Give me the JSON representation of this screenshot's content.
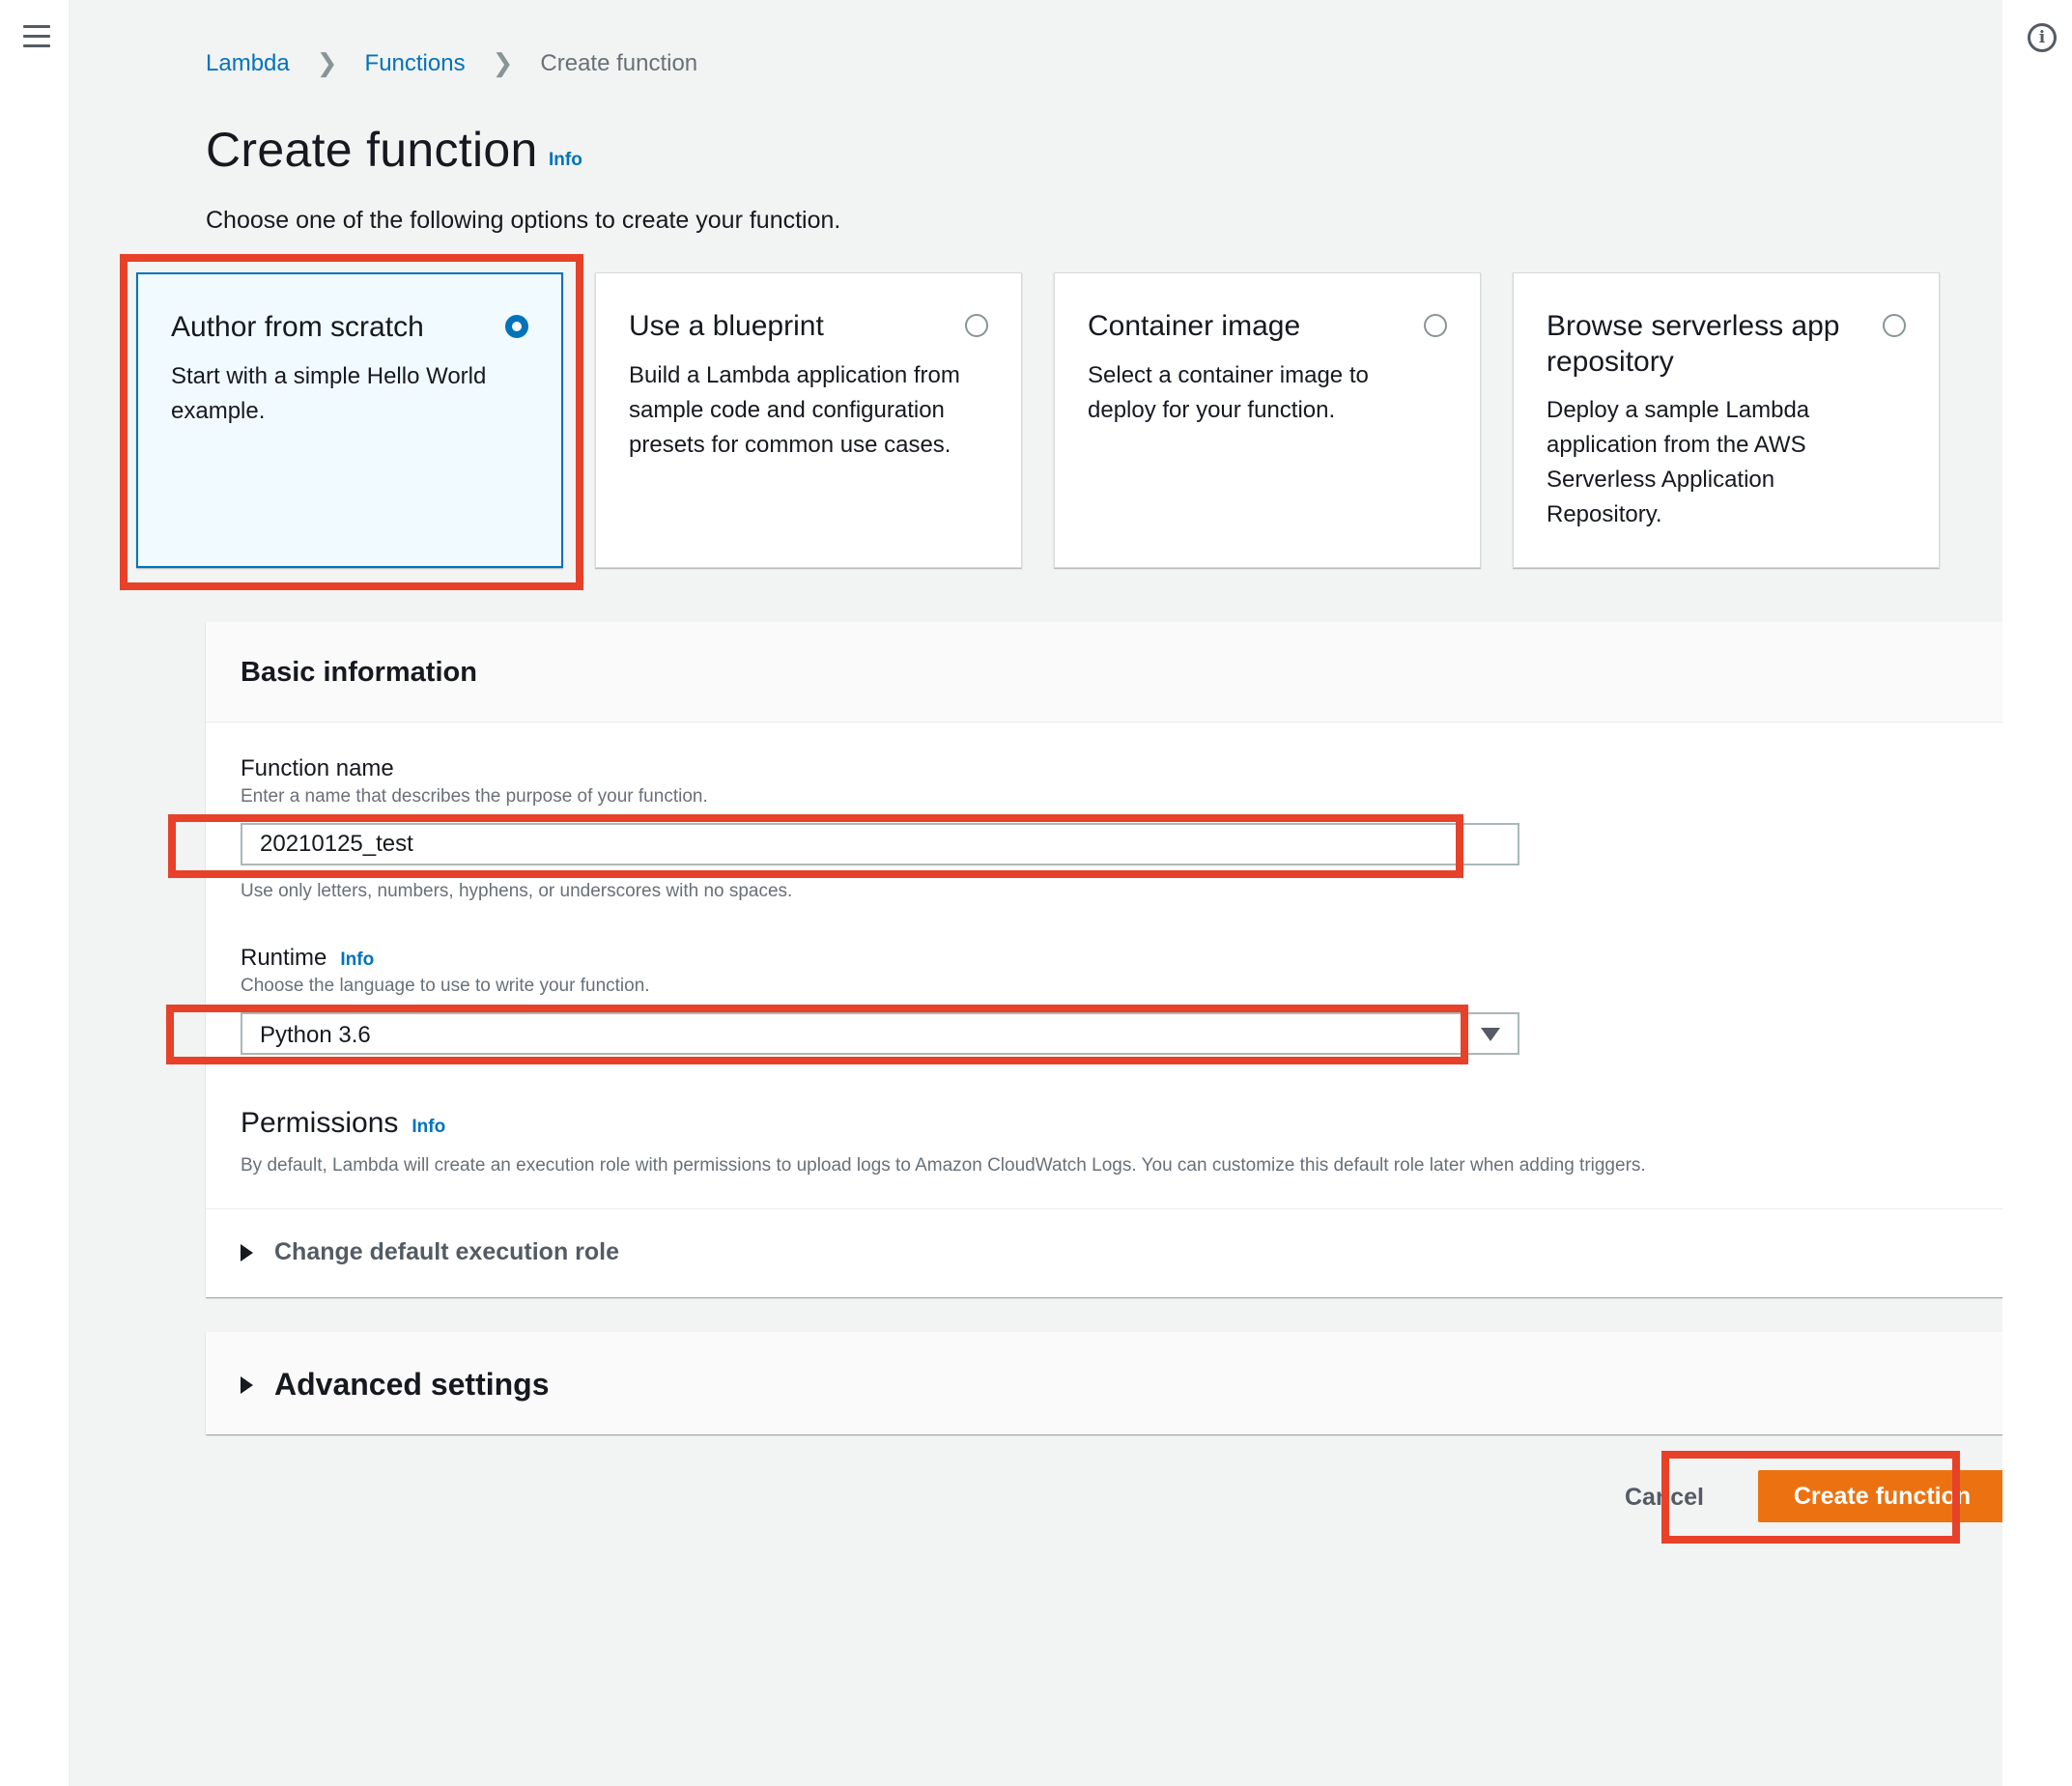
{
  "breadcrumb": {
    "item1": "Lambda",
    "item2": "Functions",
    "current": "Create function"
  },
  "page": {
    "title": "Create function",
    "title_info": "Info",
    "intro": "Choose one of the following options to create your function."
  },
  "options": [
    {
      "title": "Author from scratch",
      "description": "Start with a simple Hello World example.",
      "selected": true
    },
    {
      "title": "Use a blueprint",
      "description": "Build a Lambda application from sample code and configuration presets for common use cases.",
      "selected": false
    },
    {
      "title": "Container image",
      "description": "Select a container image to deploy for your function.",
      "selected": false
    },
    {
      "title": "Browse serverless app repository",
      "description": "Deploy a sample Lambda application from the AWS Serverless Application Repository.",
      "selected": false
    }
  ],
  "basic": {
    "heading": "Basic information",
    "function_name": {
      "label": "Function name",
      "description": "Enter a name that describes the purpose of your function.",
      "value": "20210125_test",
      "constraint": "Use only letters, numbers, hyphens, or underscores with no spaces."
    },
    "runtime": {
      "label": "Runtime",
      "info": "Info",
      "description": "Choose the language to use to write your function.",
      "value": "Python 3.6"
    },
    "permissions": {
      "label": "Permissions",
      "info": "Info",
      "description": "By default, Lambda will create an execution role with permissions to upload logs to Amazon CloudWatch Logs. You can customize this default role later when adding triggers.",
      "expander": "Change default execution role"
    }
  },
  "advanced": {
    "label": "Advanced settings"
  },
  "actions": {
    "cancel": "Cancel",
    "create": "Create function"
  },
  "colors": {
    "accent": "#0073bb",
    "primary_button": "#ec7211",
    "highlight": "#e8412a"
  }
}
